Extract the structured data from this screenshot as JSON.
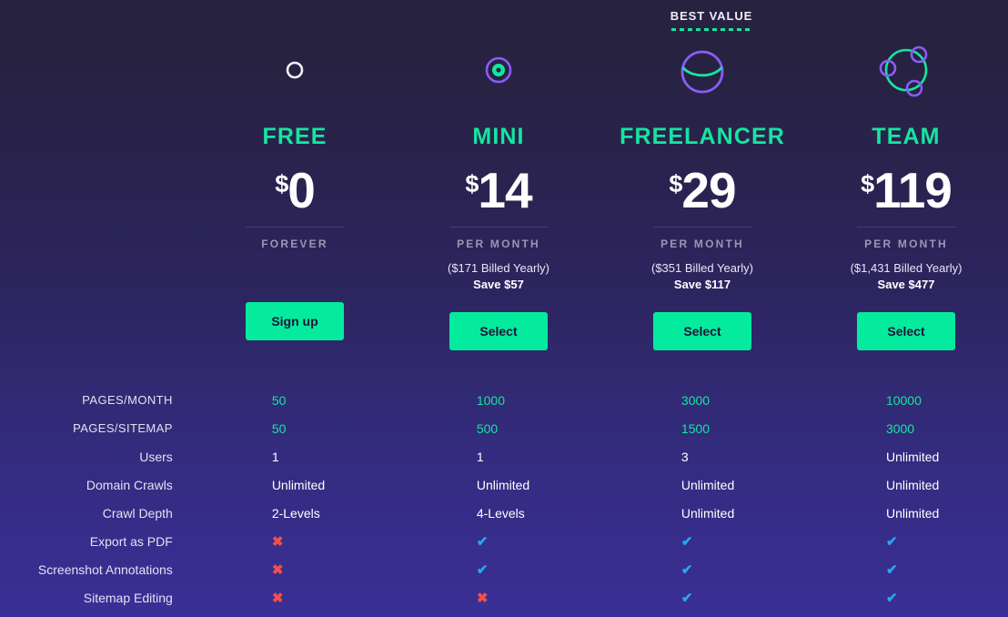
{
  "badge": {
    "label": "BEST VALUE",
    "applies_to_plan": "FREELANCER"
  },
  "colors": {
    "accent_green": "#15e5a0",
    "button_green": "#04eb9e",
    "check_blue": "#29a8ef",
    "cross_red": "#f2504b",
    "muted_text": "#9b96b6",
    "bg_top": "#272240",
    "bg_bottom": "#3a2f96",
    "icon_purple": "#8b5cf6"
  },
  "plans": [
    {
      "icon": "circle-outline-icon",
      "name": "FREE",
      "currency": "$",
      "amount": "0",
      "period": "FOREVER",
      "billed": "",
      "save": "",
      "cta": "Sign up"
    },
    {
      "icon": "concentric-circles-icon",
      "name": "MINI",
      "currency": "$",
      "amount": "14",
      "period": "PER MONTH",
      "billed": "($171 Billed Yearly)",
      "save": "Save $57",
      "cta": "Select"
    },
    {
      "icon": "circle-with-arc-icon",
      "name": "FREELANCER",
      "currency": "$",
      "amount": "29",
      "period": "PER MONTH",
      "billed": "($351 Billed Yearly)",
      "save": "Save $117",
      "cta": "Select"
    },
    {
      "icon": "network-nodes-icon",
      "name": "TEAM",
      "currency": "$",
      "amount": "119",
      "period": "PER MONTH",
      "billed": "($1,431 Billed Yearly)",
      "save": "Save $477",
      "cta": "Select"
    }
  ],
  "features": [
    {
      "label": "PAGES/MONTH",
      "style": "caps",
      "values": [
        "50",
        "1000",
        "3000",
        "10000"
      ]
    },
    {
      "label": "PAGES/SITEMAP",
      "style": "caps",
      "values": [
        "50",
        "500",
        "1500",
        "3000"
      ]
    },
    {
      "label": "Users",
      "style": "normal",
      "values": [
        "1",
        "1",
        "3",
        "Unlimited"
      ]
    },
    {
      "label": "Domain Crawls",
      "style": "normal",
      "values": [
        "Unlimited",
        "Unlimited",
        "Unlimited",
        "Unlimited"
      ]
    },
    {
      "label": "Crawl Depth",
      "style": "normal",
      "values": [
        "2-Levels",
        "4-Levels",
        "Unlimited",
        "Unlimited"
      ]
    },
    {
      "label": "Export as PDF",
      "style": "mark",
      "values": [
        "no",
        "yes",
        "yes",
        "yes"
      ]
    },
    {
      "label": "Screenshot Annotations",
      "style": "mark",
      "values": [
        "no",
        "yes",
        "yes",
        "yes"
      ]
    },
    {
      "label": "Sitemap Editing",
      "style": "mark",
      "values": [
        "no",
        "no",
        "yes",
        "yes"
      ]
    }
  ],
  "marks": {
    "yes": "✔",
    "no": "✖"
  }
}
